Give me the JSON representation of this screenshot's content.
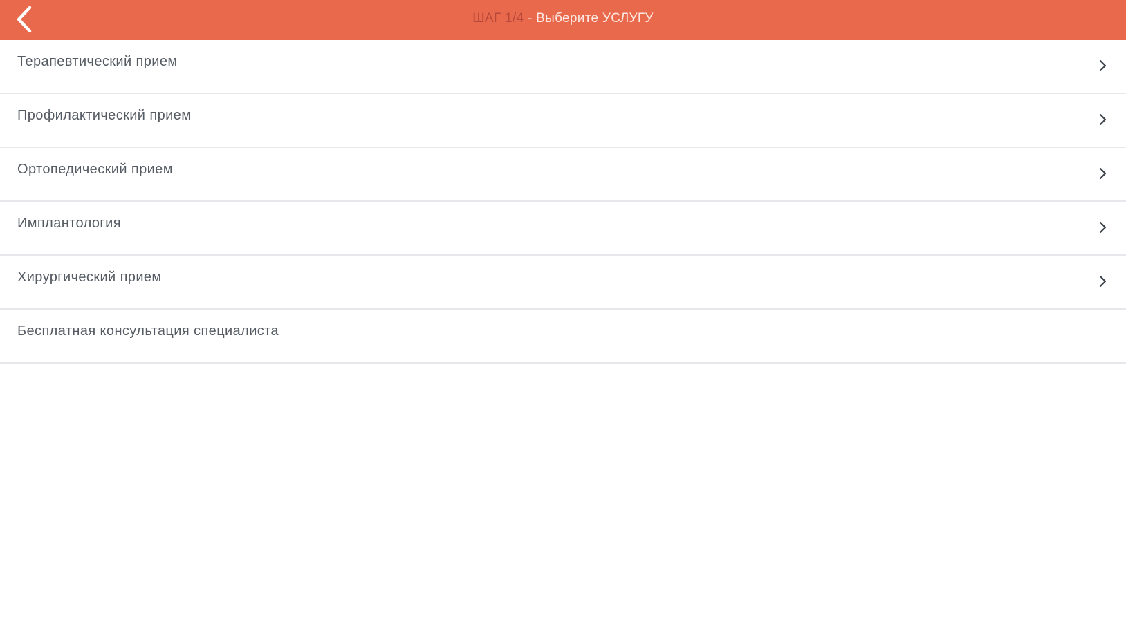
{
  "header": {
    "back_icon": "chevron-left-icon",
    "title_step": "ШАГ 1/4",
    "title_separator": " - ",
    "title_text": "Выберите УСЛУГУ",
    "bg_color": "#e8694b"
  },
  "services": [
    {
      "label": "Терапевтический прием",
      "has_chevron": true
    },
    {
      "label": "Профилактический прием",
      "has_chevron": true
    },
    {
      "label": "Ортопедический прием",
      "has_chevron": true
    },
    {
      "label": "Имплантология",
      "has_chevron": true
    },
    {
      "label": "Хирургический прием",
      "has_chevron": true
    },
    {
      "label": "Бесплатная консультация специалиста",
      "has_chevron": false
    }
  ]
}
